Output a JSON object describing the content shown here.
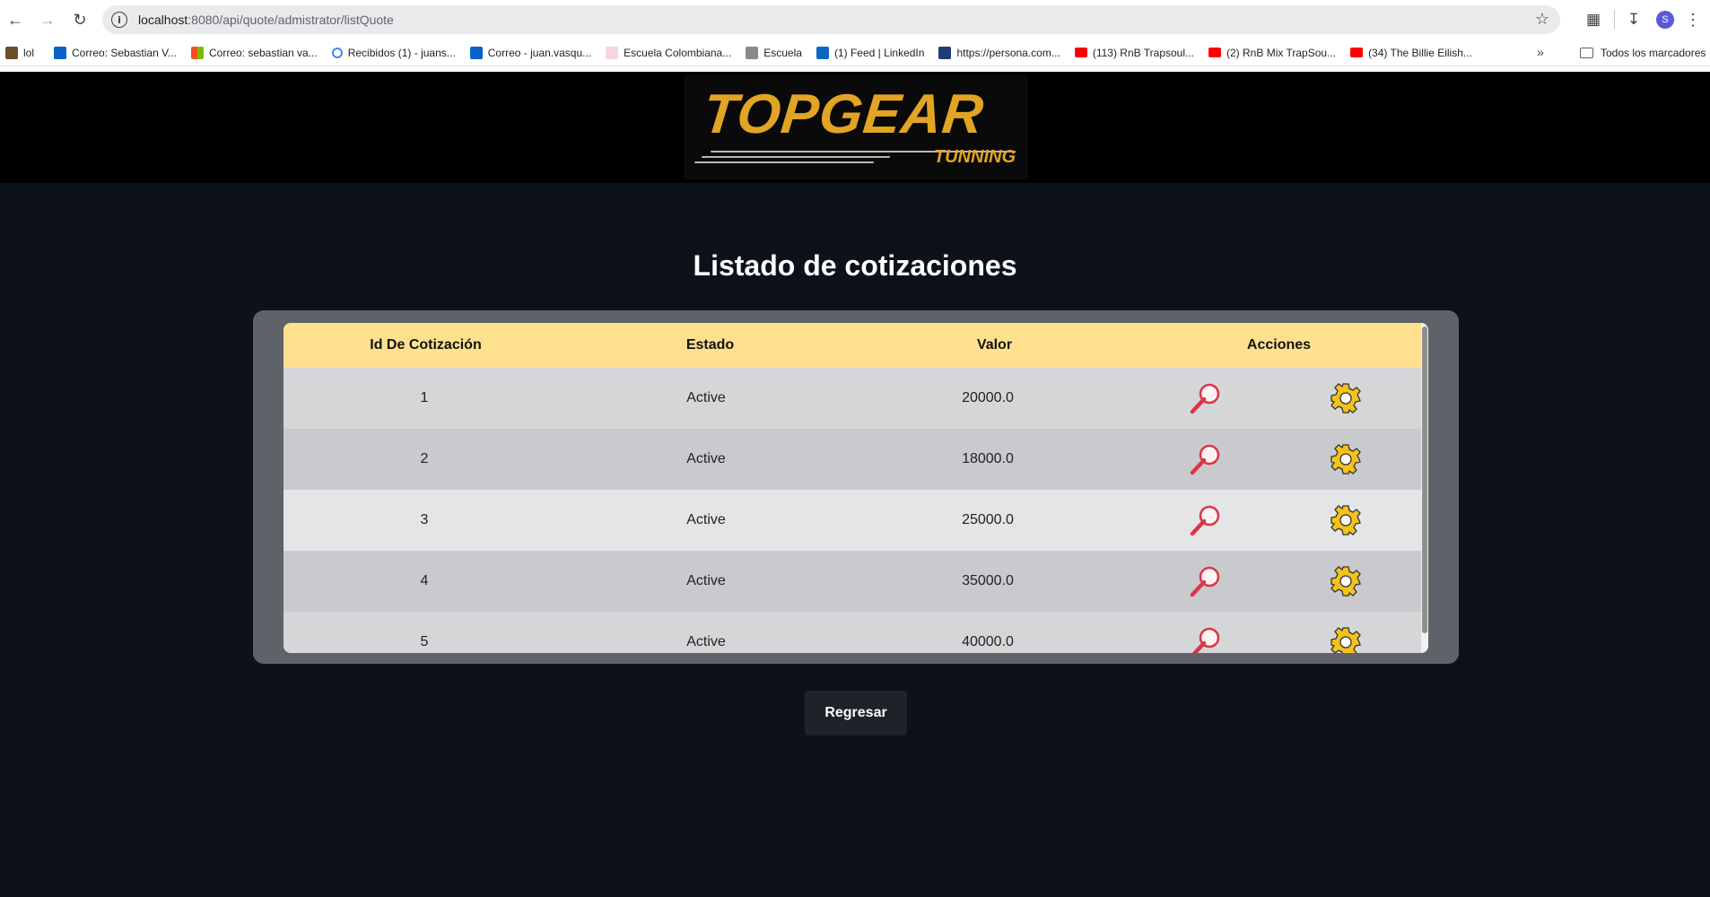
{
  "browser": {
    "url_host": "localhost",
    "url_rest": ":8080/api/quote/admistrator/listQuote",
    "bookmarks": [
      {
        "label": "lol",
        "icon": "lol-favicon",
        "color": "#6b4f2a"
      },
      {
        "label": "Correo: Sebastian V...",
        "icon": "outlook-icon",
        "color": "#0a64c8"
      },
      {
        "label": "Correo: sebastian va...",
        "icon": "microsoft-icon",
        "color": "#f25022"
      },
      {
        "label": "Recibidos (1) - juans...",
        "icon": "google-icon",
        "color": "#4285f4"
      },
      {
        "label": "Correo - juan.vasqu...",
        "icon": "outlook-icon",
        "color": "#0a64c8"
      },
      {
        "label": "Escuela Colombiana...",
        "icon": "escuela-favicon",
        "color": "#b05a7a"
      },
      {
        "label": "Escuela",
        "icon": "school-favicon",
        "color": "#7a7a7a"
      },
      {
        "label": "(1) Feed | LinkedIn",
        "icon": "linkedin-icon",
        "color": "#0a66c2"
      },
      {
        "label": "https://persona.com...",
        "icon": "persona-favicon",
        "color": "#1f3b75"
      },
      {
        "label": "(113) RnB Trapsoul...",
        "icon": "youtube-icon",
        "color": "#ff0000"
      },
      {
        "label": "(2) RnB Mix TrapSou...",
        "icon": "youtube-icon",
        "color": "#ff0000"
      },
      {
        "label": "(34) The Billie Eilish...",
        "icon": "youtube-icon",
        "color": "#ff0000"
      }
    ],
    "bookmarks_more": "»",
    "all_bookmarks": "Todos los marcadores",
    "profile_initial": "S"
  },
  "logo": {
    "main": "TOPGEAR",
    "sub": "TUNNING",
    "color": "#e2a425"
  },
  "page": {
    "title": "Listado de cotizaciones",
    "back_button": "Regresar"
  },
  "table": {
    "headers": [
      "Id De Cotización",
      "Estado",
      "Valor",
      "Acciones"
    ],
    "rows": [
      {
        "id": "1",
        "estado": "Active",
        "valor": "20000.0"
      },
      {
        "id": "2",
        "estado": "Active",
        "valor": "18000.0"
      },
      {
        "id": "3",
        "estado": "Active",
        "valor": "25000.0"
      },
      {
        "id": "4",
        "estado": "Active",
        "valor": "35000.0"
      },
      {
        "id": "5",
        "estado": "Active",
        "valor": "40000.0"
      }
    ],
    "header_color": "#ffe08e",
    "view_icon": "magnifier-icon",
    "edit_icon": "gear-icon"
  }
}
